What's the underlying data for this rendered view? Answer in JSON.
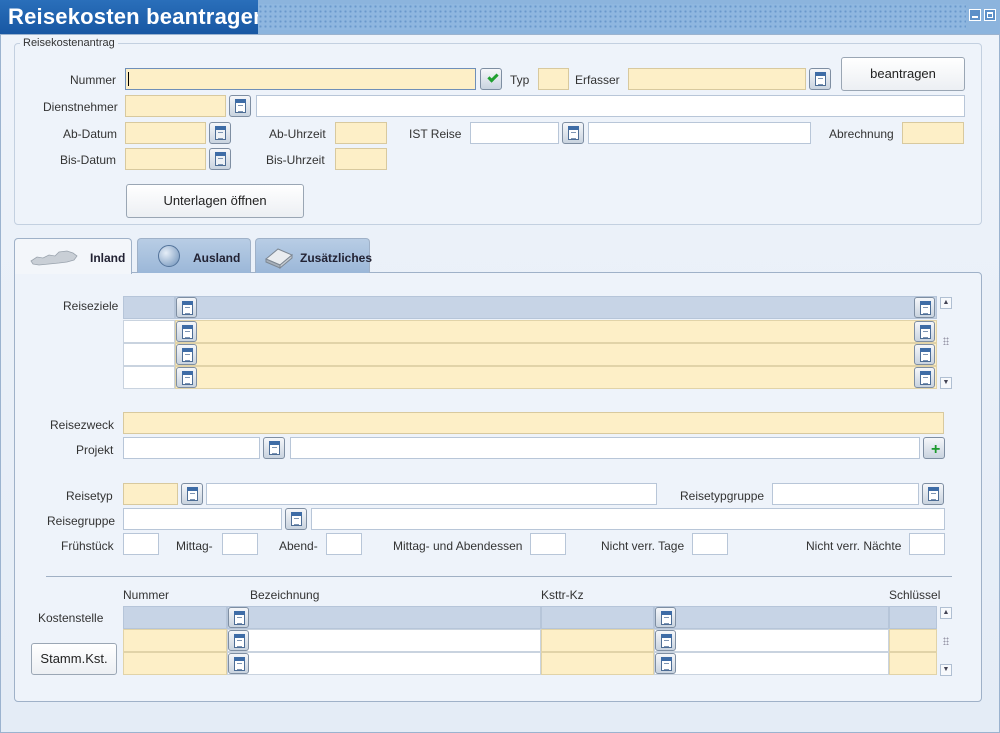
{
  "window": {
    "title": "Reisekosten beantragen"
  },
  "form": {
    "group_label": "Reisekostenantrag",
    "labels": {
      "nummer": "Nummer",
      "typ": "Typ",
      "erfasser": "Erfasser",
      "dienstnehmer": "Dienstnehmer",
      "ab_datum": "Ab-Datum",
      "ab_uhrzeit": "Ab-Uhrzeit",
      "ist_reise": "IST Reise",
      "abrechnung": "Abrechnung",
      "bis_datum": "Bis-Datum",
      "bis_uhrzeit": "Bis-Uhrzeit"
    },
    "values": {
      "nummer": "",
      "typ": "",
      "erfasser": "",
      "dienstnehmer_nr": "",
      "dienstnehmer_name": "",
      "ab_datum": "",
      "ab_uhrzeit": "",
      "ist_reise_nr": "",
      "ist_reise_text": "",
      "abrechnung": "",
      "bis_datum": "",
      "bis_uhrzeit": ""
    },
    "buttons": {
      "beantragen": "beantragen",
      "unterlagen": "Unterlagen öffnen"
    }
  },
  "tabs": [
    {
      "label": "Inland",
      "icon": "austria-map-icon",
      "active": true
    },
    {
      "label": "Ausland",
      "icon": "globe-icon",
      "active": false
    },
    {
      "label": "Zusätzliches",
      "icon": "book-icon",
      "active": false
    }
  ],
  "inland": {
    "labels": {
      "reiseziele": "Reiseziele",
      "reisezweck": "Reisezweck",
      "projekt": "Projekt",
      "reisetyp": "Reisetyp",
      "reisetypgruppe": "Reisetypgruppe",
      "reisegruppe": "Reisegruppe",
      "fruehstueck": "Frühstück",
      "mittag": "Mittag-",
      "abend": "Abend-",
      "mittag_abend": "Mittag- und Abendessen",
      "nicht_verr_tage": "Nicht verr. Tage",
      "nicht_verr_naechte": "Nicht verr. Nächte"
    },
    "kosten": {
      "headers": {
        "nummer": "Nummer",
        "bezeichnung": "Bezeichnung",
        "ksttr_kz": "Ksttr-Kz",
        "schluessel": "Schlüssel"
      },
      "row_label": "Kostenstelle",
      "button": "Stamm.Kst."
    }
  }
}
